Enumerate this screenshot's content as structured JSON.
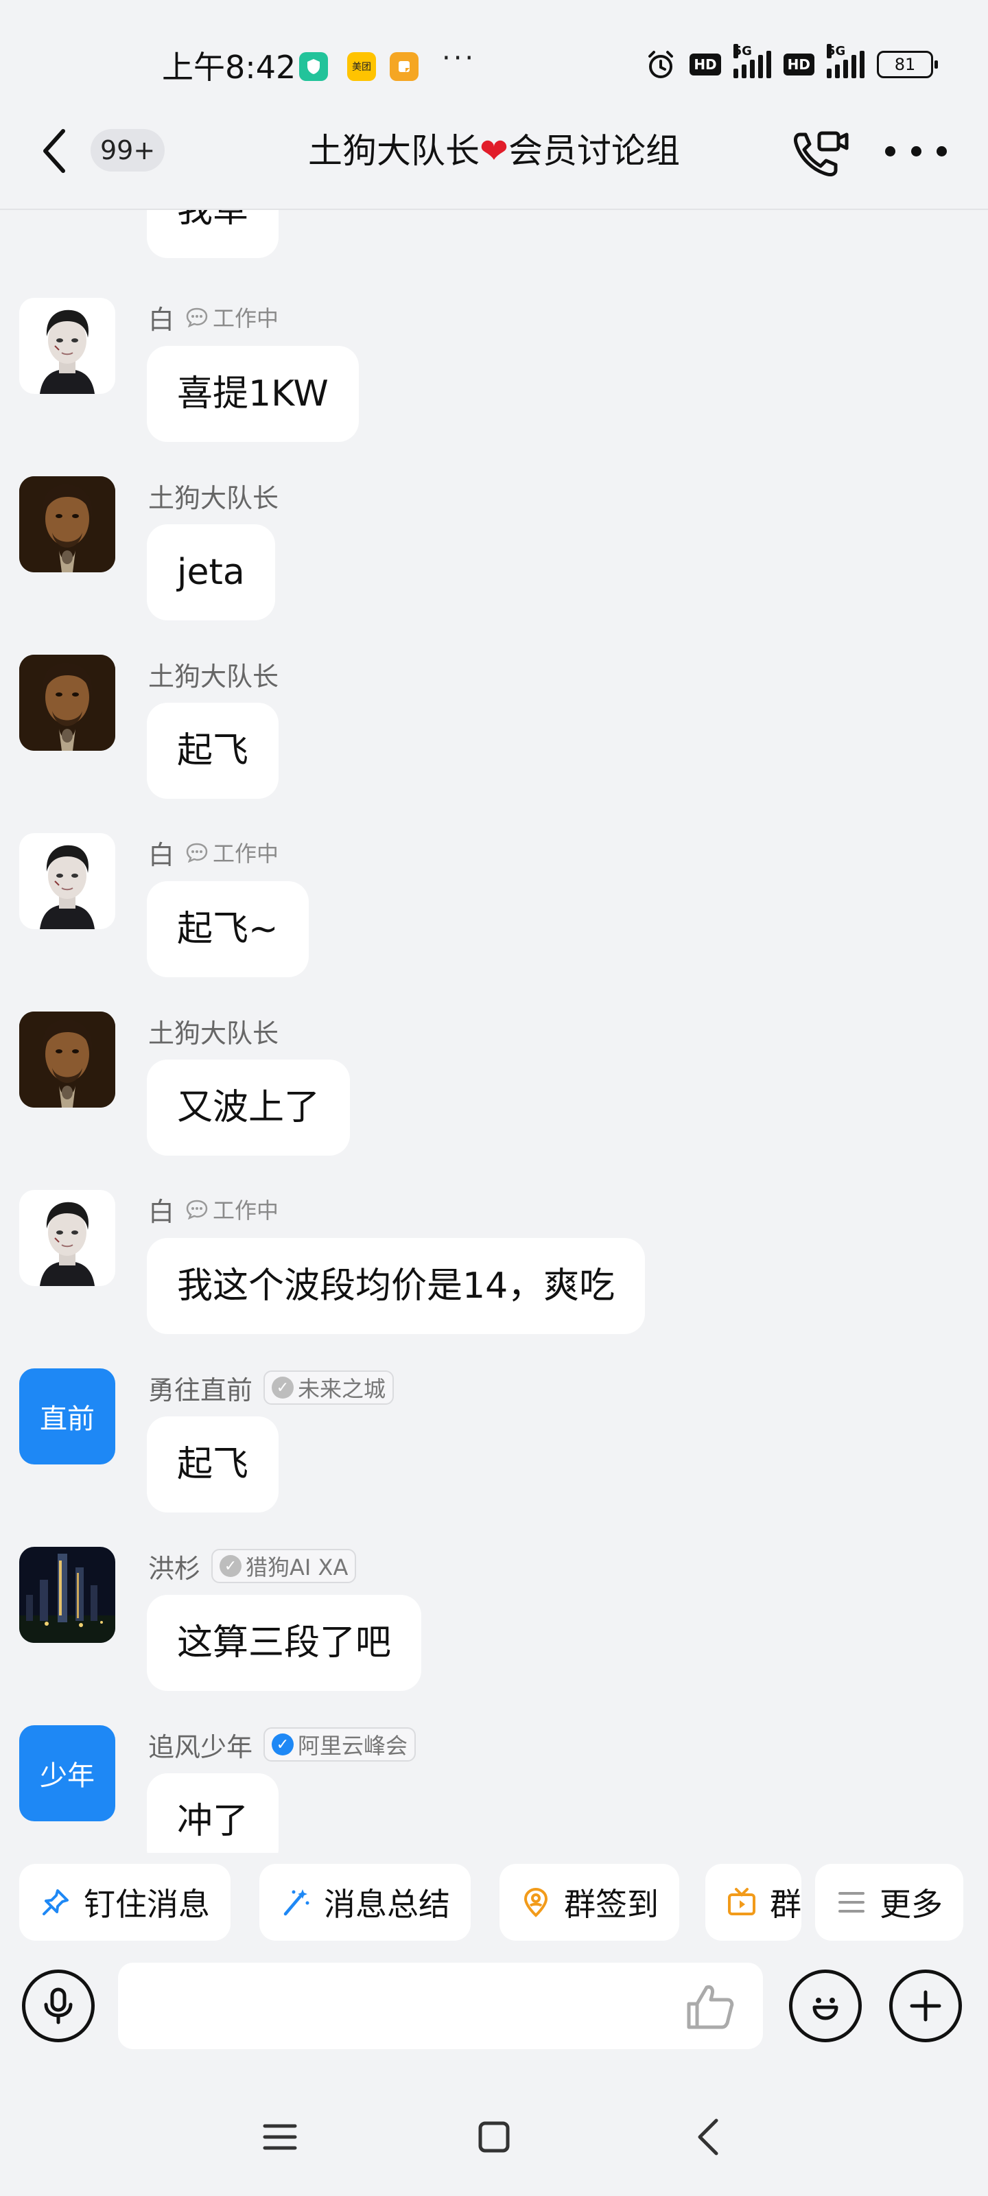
{
  "status_bar": {
    "time": "上午8:42",
    "app_icons": [
      {
        "name": "shield-app-icon",
        "color": "#22c39a",
        "text": ""
      },
      {
        "name": "meituan-app-icon",
        "color": "#ffc300",
        "text": "美团"
      },
      {
        "name": "notes-app-icon",
        "color": "#f5a623",
        "text": ""
      }
    ],
    "more_notifications": "···",
    "hd_label": "HD",
    "network_label": "5G",
    "battery_level": "81"
  },
  "header": {
    "unread_count": "99+",
    "title_left": "土狗大队长",
    "title_heart": "❤",
    "title_right": "会员讨论组"
  },
  "partial_top_message": "我草",
  "messages": [
    {
      "sender": "白",
      "status": "工作中",
      "text": "喜提1KW",
      "avatar": "portrait-pale"
    },
    {
      "sender": "土狗大队长",
      "status": "",
      "text": "jeta",
      "avatar": "portrait-warrior"
    },
    {
      "sender": "土狗大队长",
      "status": "",
      "text": "起飞",
      "avatar": "portrait-warrior"
    },
    {
      "sender": "白",
      "status": "工作中",
      "text": "起飞~",
      "avatar": "portrait-pale"
    },
    {
      "sender": "土狗大队长",
      "status": "",
      "text": "又波上了",
      "avatar": "portrait-warrior"
    },
    {
      "sender": "白",
      "status": "工作中",
      "text": "我这个波段均价是14，爽吃",
      "avatar": "portrait-pale"
    },
    {
      "sender": "勇往直前",
      "tag": "未来之城",
      "tag_type": "gray",
      "text": "起飞",
      "avatar_text": "直前"
    },
    {
      "sender": "洪杉",
      "tag": "猎狗AI XA",
      "tag_type": "gray",
      "text": "这算三段了吧",
      "avatar": "night-city"
    },
    {
      "sender": "追风少年",
      "tag": "阿里云峰会",
      "tag_type": "verified",
      "text": "冲了",
      "avatar_text": "少年"
    }
  ],
  "quick_actions": {
    "pin": "钉住消息",
    "summary": "消息总结",
    "checkin": "群签到",
    "group_partial": "群",
    "more": "更多"
  },
  "input": {
    "placeholder": ""
  },
  "colors": {
    "background": "#f2f3f5",
    "bubble": "#ffffff",
    "accent_blue": "#1e88f5",
    "checkin_orange": "#f29b1a",
    "heart_red": "#e11d2a"
  }
}
